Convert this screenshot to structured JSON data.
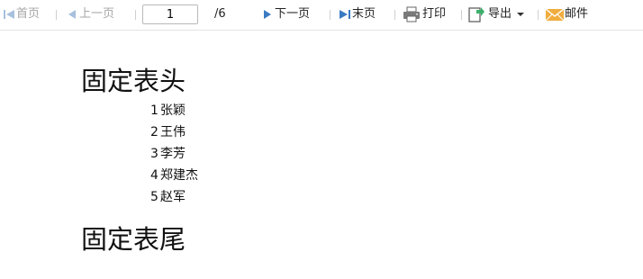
{
  "toolbar": {
    "first_page_label": "首页",
    "prev_page_label": "上一页",
    "current_page": "1",
    "total_pages": "/6",
    "next_page_label": "下一页",
    "last_page_label": "末页",
    "print_label": "打印",
    "export_label": "导出",
    "mail_label": "邮件",
    "icons": {
      "first": "first-page-icon",
      "prev": "prev-page-icon",
      "next": "next-page-icon",
      "last": "last-page-icon",
      "print": "printer-icon",
      "export": "export-icon",
      "mail": "mail-icon"
    },
    "colors": {
      "nav_arrow_enabled": "#3a7ac2",
      "nav_arrow_disabled": "#a7c1dd",
      "mail": "#f0ad3e",
      "export": "#3bb06b"
    }
  },
  "report": {
    "header_title": "固定表头",
    "rows": [
      {
        "index": "1",
        "name": "张颖"
      },
      {
        "index": "2",
        "name": "王伟"
      },
      {
        "index": "3",
        "name": "李芳"
      },
      {
        "index": "4",
        "name": "郑建杰"
      },
      {
        "index": "5",
        "name": "赵军"
      }
    ],
    "footer_title": "固定表尾"
  }
}
